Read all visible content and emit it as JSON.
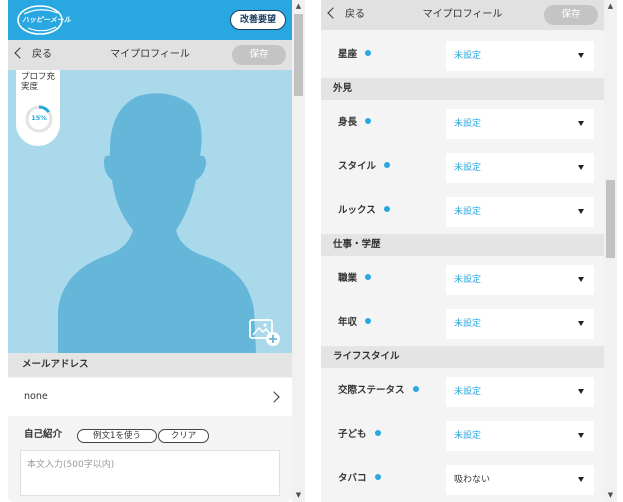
{
  "app": {
    "logo_text": "ハッピーメール",
    "improve_button": "改善要望"
  },
  "nav": {
    "back_label": "戻る",
    "title": "マイプロフィール",
    "save_label": "保存"
  },
  "profile": {
    "completion_label": "プロフ充実度",
    "completion_value": "15%",
    "completion_fraction": 0.15
  },
  "email": {
    "section_title": "メールアドレス",
    "value": "none"
  },
  "intro": {
    "label": "自己紹介",
    "example_button": "例文1を使う",
    "clear_button": "クリア",
    "placeholder": "本文入力(500字以内)"
  },
  "fields": {
    "zodiac": {
      "label": "星座",
      "value": "未設定"
    },
    "height": {
      "label": "身長",
      "value": "未設定"
    },
    "style": {
      "label": "スタイル",
      "value": "未設定"
    },
    "looks": {
      "label": "ルックス",
      "value": "未設定"
    },
    "job": {
      "label": "職業",
      "value": "未設定"
    },
    "income": {
      "label": "年収",
      "value": "未設定"
    },
    "marital": {
      "label": "交際ステータス",
      "value": "未設定"
    },
    "children": {
      "label": "子ども",
      "value": "未設定"
    },
    "tobacco": {
      "label": "タバコ",
      "value": "吸わない"
    }
  },
  "categories": {
    "appearance": "外見",
    "work": "仕事・学歴",
    "lifestyle": "ライフスタイル"
  },
  "colors": {
    "accent": "#29a7e1",
    "nav_bg": "#e1e1e1",
    "photo_bg": "#aad9ec",
    "silhouette": "#65b7d9"
  }
}
